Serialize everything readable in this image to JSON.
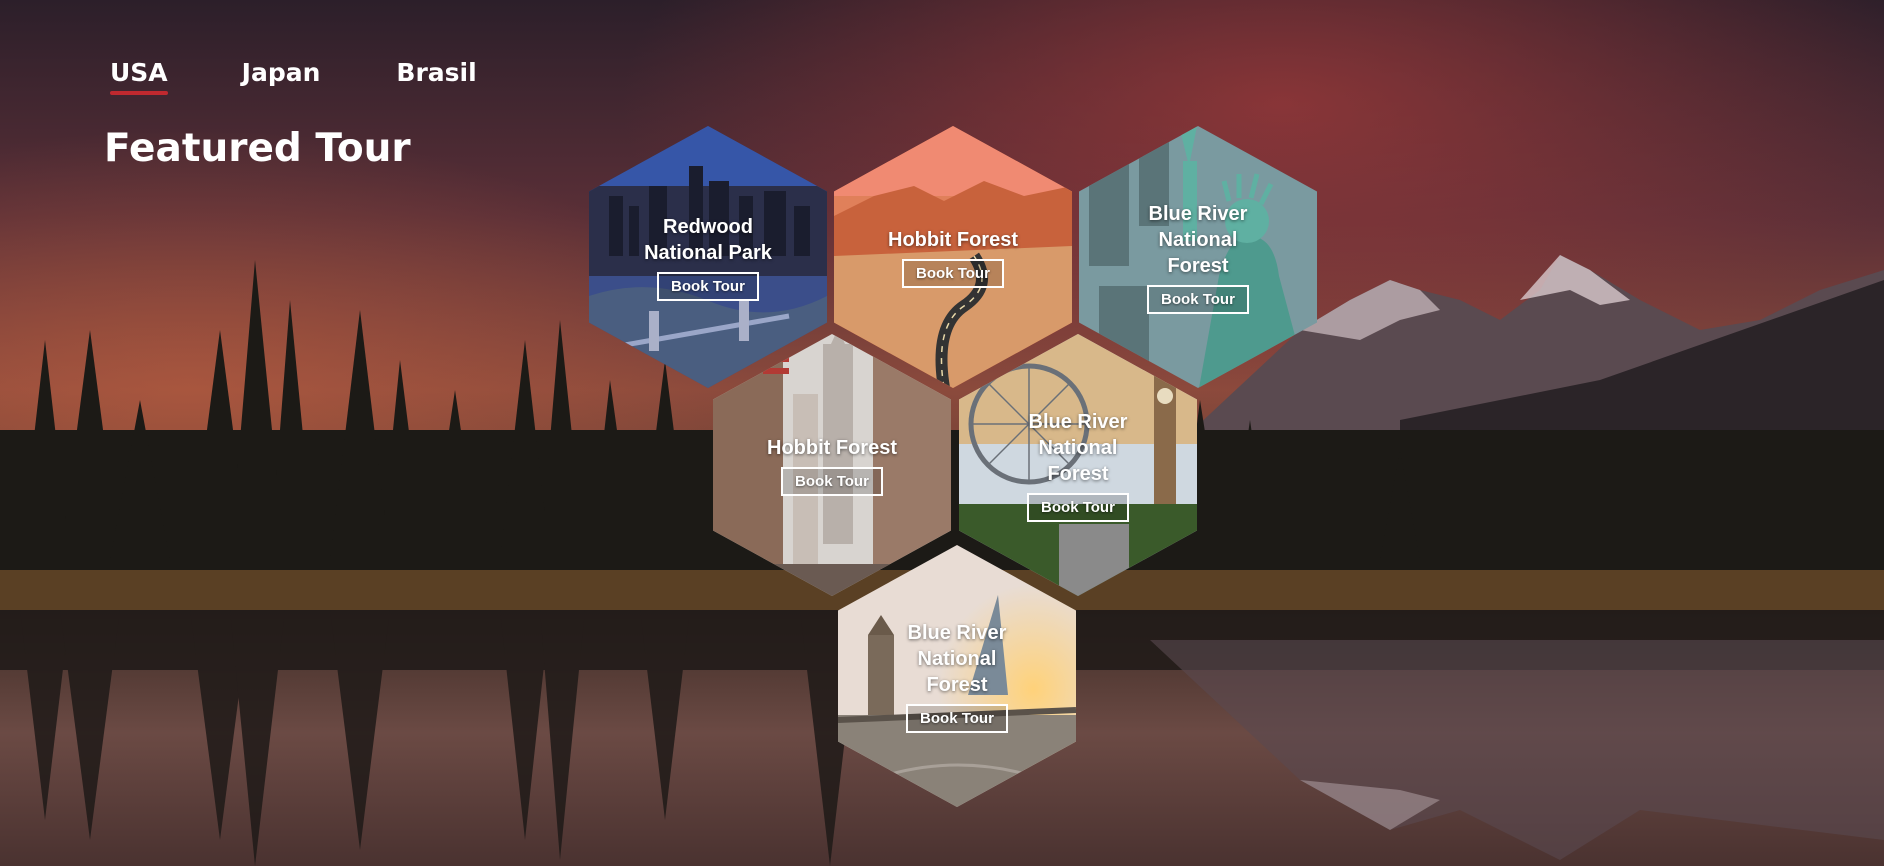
{
  "nav": {
    "tabs": [
      {
        "label": "USA",
        "active": true
      },
      {
        "label": "Japan",
        "active": false
      },
      {
        "label": "Brasil",
        "active": false
      }
    ],
    "accent_color": "#c0292f"
  },
  "heading": "Featured Tour",
  "tours": [
    {
      "name": "Redwood National Park",
      "button": "Book Tour",
      "image": "london-tower-bridge-city"
    },
    {
      "name": "Hobbit Forest",
      "button": "Book Tour",
      "image": "red-rock-desert-road"
    },
    {
      "name": "Blue River National Forest",
      "button": "Book Tour",
      "image": "statue-of-liberty"
    },
    {
      "name": "Hobbit Forest",
      "button": "Book Tour",
      "image": "new-york-street"
    },
    {
      "name": "Blue River National Forest",
      "button": "Book Tour",
      "image": "london-eye-big-ben"
    },
    {
      "name": "Blue River National Forest",
      "button": "Book Tour",
      "image": "tower-bridge-sunset"
    }
  ]
}
